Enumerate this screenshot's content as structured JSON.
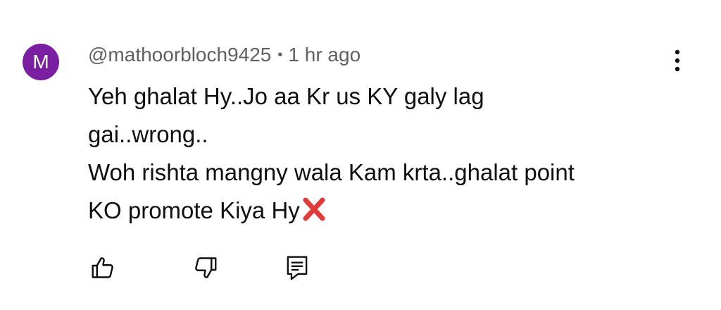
{
  "comment": {
    "avatar_initial": "M",
    "avatar_color": "#7b1fa2",
    "author": "@mathoorbloch9425",
    "separator": "•",
    "timestamp": "1 hr ago",
    "text_lines": [
      "Yeh ghalat Hy..Jo aa Kr us KY galy lag",
      "gai..wrong..",
      "Woh rishta mangny wala Kam krta..ghalat point",
      "KO promote Kiya Hy"
    ],
    "trailing_emoji": "cross-mark-emoji",
    "actions": {
      "like_icon": "thumbs-up-icon",
      "dislike_icon": "thumbs-down-icon",
      "reply_icon": "reply-comment-icon",
      "menu_icon": "more-vertical-icon"
    }
  }
}
